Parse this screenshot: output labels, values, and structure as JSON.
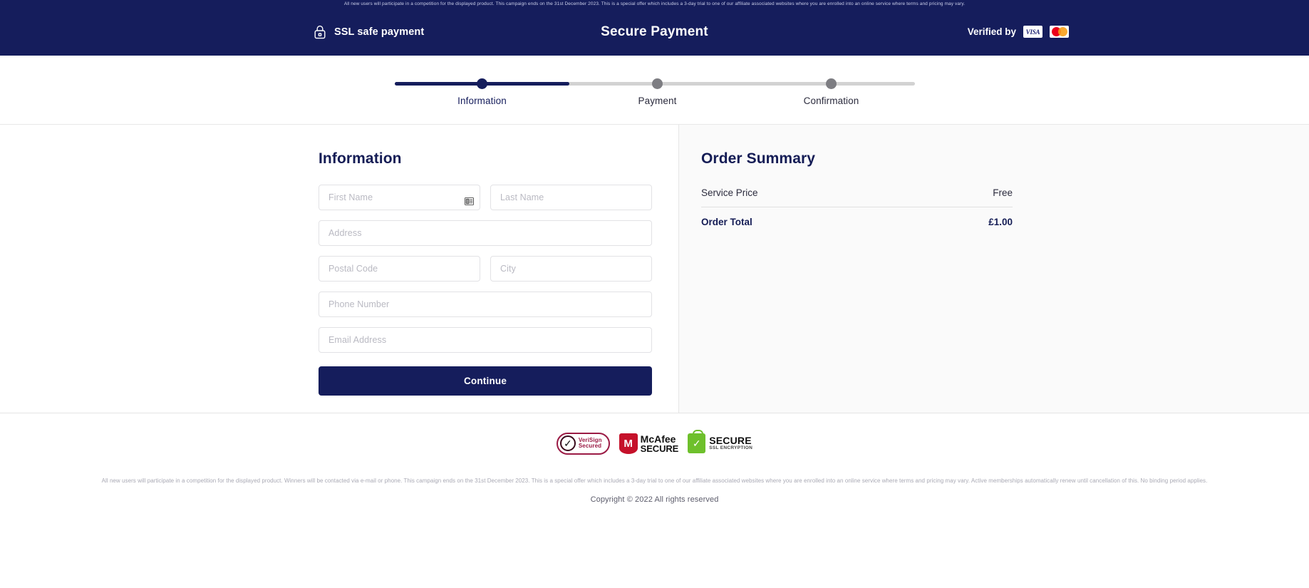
{
  "banner": {
    "text": "All new users will participate in a competition for the displayed product. This campaign ends on the 31st December 2023. This is a special offer which includes a 3-day trial to one of our affiliate associated websites where you are enrolled into an online service where terms and pricing may vary."
  },
  "header": {
    "ssl_label": "SSL safe payment",
    "title": "Secure Payment",
    "verified_label": "Verified by",
    "visa_label": "VISA",
    "lock_icon": "lock-icon",
    "background_color": "#151d5c"
  },
  "stepper": {
    "active_index": 0,
    "steps": [
      {
        "label": "Information"
      },
      {
        "label": "Payment"
      },
      {
        "label": "Confirmation"
      }
    ],
    "active_color": "#151d5c",
    "inactive_color": "#7d7d82",
    "track_color": "#d2d2d2"
  },
  "form": {
    "title": "Information",
    "fields": [
      {
        "name": "first-name",
        "placeholder": "First Name",
        "value": "",
        "width": "half",
        "icon": "contact-card-icon"
      },
      {
        "name": "last-name",
        "placeholder": "Last Name",
        "value": "",
        "width": "half",
        "icon": ""
      },
      {
        "name": "address",
        "placeholder": "Address",
        "value": "",
        "width": "full",
        "icon": ""
      },
      {
        "name": "postal-code",
        "placeholder": "Postal Code",
        "value": "",
        "width": "half",
        "icon": ""
      },
      {
        "name": "city",
        "placeholder": "City",
        "value": "",
        "width": "half",
        "icon": ""
      },
      {
        "name": "phone-number",
        "placeholder": "Phone Number",
        "value": "",
        "width": "full",
        "icon": ""
      },
      {
        "name": "email-address",
        "placeholder": "Email Address",
        "value": "",
        "width": "full",
        "icon": ""
      }
    ],
    "submit_label": "Continue"
  },
  "summary": {
    "title": "Order Summary",
    "rows": [
      {
        "label": "Service Price",
        "value": "Free"
      }
    ],
    "total_label": "Order Total",
    "total_value": "£1.00"
  },
  "footer": {
    "badges": [
      {
        "name": "verisign-badge",
        "line1": "VeriSign",
        "line2": "Secured"
      },
      {
        "name": "mcafee-badge",
        "line1": "McAfee",
        "line2": "SECURE",
        "mark": "M"
      },
      {
        "name": "ssl-encryption-badge",
        "line1": "SECURE",
        "line2": "SSL ENCRYPTION"
      }
    ],
    "disclaimer": "All new users will participate in a competition for the displayed product. Winners will be contacted via e-mail or phone. This campaign ends on the 31st December 2023. This is a special offer which includes a 3-day trial to one of our affiliate associated websites where you are enrolled into an online service where terms and pricing may vary. Active memberships automatically renew until cancellation of this. No binding period applies.",
    "copyright": "Copyright © 2022 All rights reserved"
  }
}
